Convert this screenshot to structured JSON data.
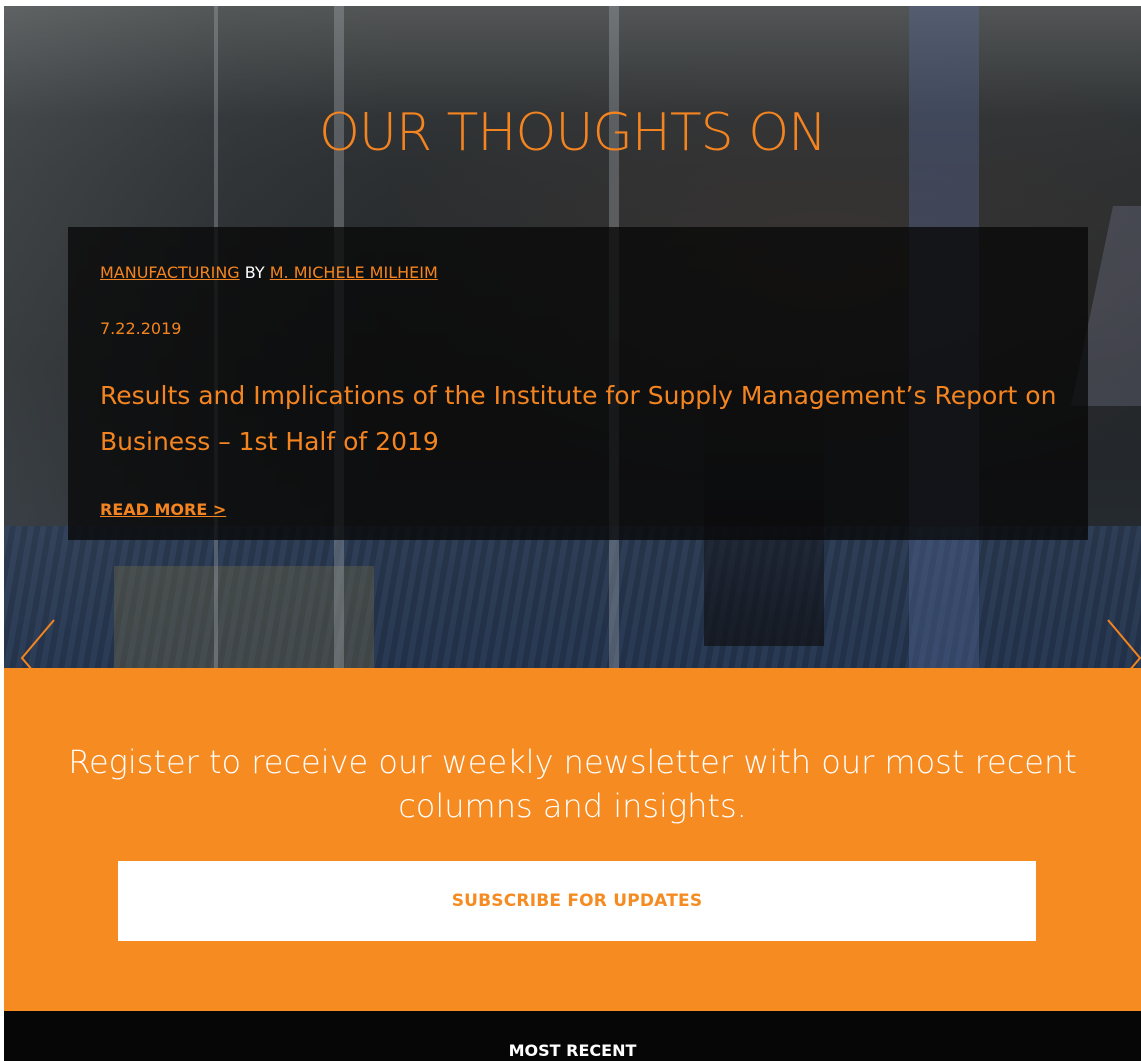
{
  "hero": {
    "title": "OUR THOUGHTS ON"
  },
  "post": {
    "category": "MANUFACTURING",
    "by": "BY",
    "author": "M. MICHELE MILHEIM",
    "date": "7.22.2019",
    "title": "Results and Implications of the Institute for Supply Management’s Report on Business – 1st Half of 2019",
    "read_more": "READ MORE >"
  },
  "carousel": {
    "prev_icon": "chevron-left-icon",
    "next_icon": "chevron-right-icon"
  },
  "newsletter": {
    "text": "Register to receive our weekly newsletter with our most recent columns and insights.",
    "button_label": "SUBSCRIBE FOR UPDATES"
  },
  "most_recent": {
    "label": "MOST RECENT"
  },
  "colors": {
    "accent": "#f68b22",
    "card_bg": "#080808",
    "footer_bg": "#060606"
  }
}
